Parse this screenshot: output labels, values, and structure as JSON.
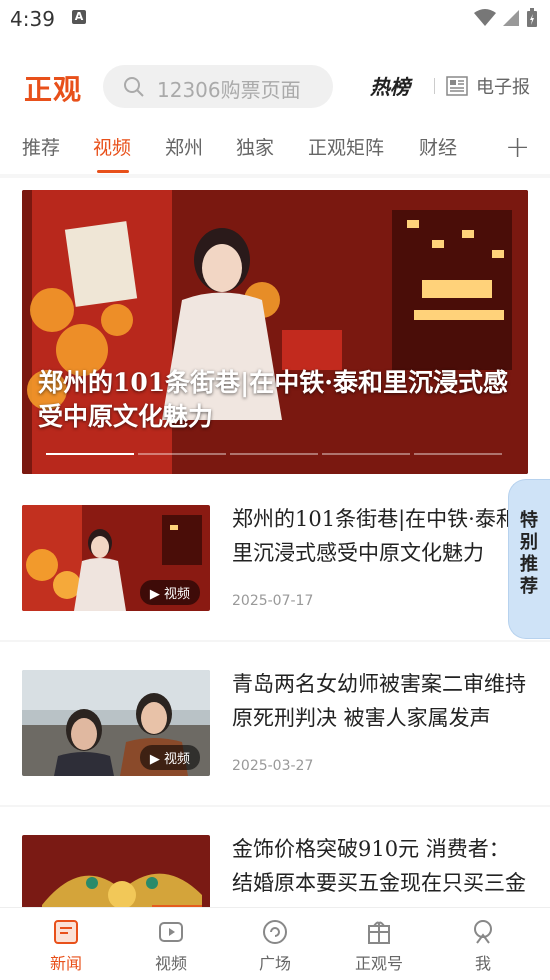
{
  "status_bar": {
    "time": "4:39",
    "notif_letter": "A"
  },
  "header": {
    "logo": "正观",
    "search_placeholder": "12306购票页面",
    "hotlist_label": "热榜",
    "epaper_label": "电子报"
  },
  "tabs": [
    "推荐",
    "视频",
    "郑州",
    "独家",
    "正观矩阵",
    "财经"
  ],
  "active_tab": "视频",
  "banner": {
    "title": "郑州的101条街巷|在中铁·泰和里沉浸式感受中原文化魅力",
    "dots_total": 5,
    "dots_active": 1
  },
  "special_tab_label": "特别推荐",
  "news": [
    {
      "title": "郑州的101条街巷|在中铁·泰和里沉浸式感受中原文化魅力",
      "date": "2025-07-17",
      "badge": "视频"
    },
    {
      "title": "青岛两名女幼师被害案二审维持原死刑判决 被害人家属发声",
      "date": "2025-03-27",
      "badge": "视频"
    },
    {
      "title": "金饰价格突破910元 消费者：结婚原本要买五金现在只买三金",
      "date": "",
      "badge": ""
    }
  ],
  "bottom_nav": [
    "新闻",
    "视频",
    "广场",
    "正观号",
    "我"
  ],
  "active_nav": "新闻",
  "colors": {
    "accent": "#e8501a",
    "special_tab_bg": "#cfe3f7"
  }
}
